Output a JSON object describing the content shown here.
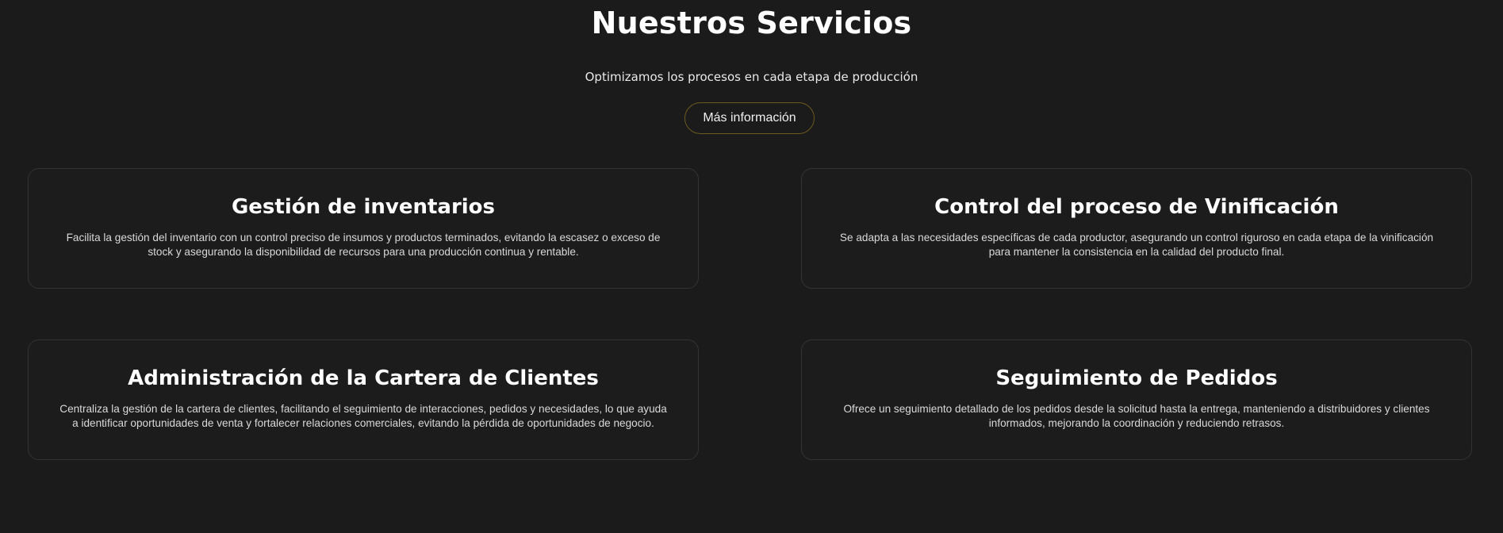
{
  "section": {
    "title": "Nuestros Servicios",
    "subtitle": "Optimizamos los procesos en cada etapa de producción",
    "cta_label": "Más información"
  },
  "colors": {
    "background": "#1b1b1b",
    "card_border": "#333333",
    "button_border": "#6d5a1e",
    "text": "#ffffff"
  },
  "services": [
    {
      "title": "Gestión de inventarios",
      "description": "Facilita la gestión del inventario con un control preciso de insumos y productos terminados, evitando la escasez o exceso de stock y asegurando la disponibilidad de recursos para una producción continua y rentable."
    },
    {
      "title": "Control del proceso de Vinificación",
      "description": "Se adapta a las necesidades específicas de cada productor, asegurando un control riguroso en cada etapa de la vinificación para mantener la consistencia en la calidad del producto final."
    },
    {
      "title": "Administración de la Cartera de Clientes",
      "description": "Centraliza la gestión de la cartera de clientes, facilitando el seguimiento de interacciones, pedidos y necesidades, lo que ayuda a identificar oportunidades de venta y fortalecer relaciones comerciales, evitando la pérdida de oportunidades de negocio."
    },
    {
      "title": "Seguimiento de Pedidos",
      "description": "Ofrece un seguimiento detallado de los pedidos desde la solicitud hasta la entrega, manteniendo a distribuidores y clientes informados, mejorando la coordinación y reduciendo retrasos."
    }
  ]
}
